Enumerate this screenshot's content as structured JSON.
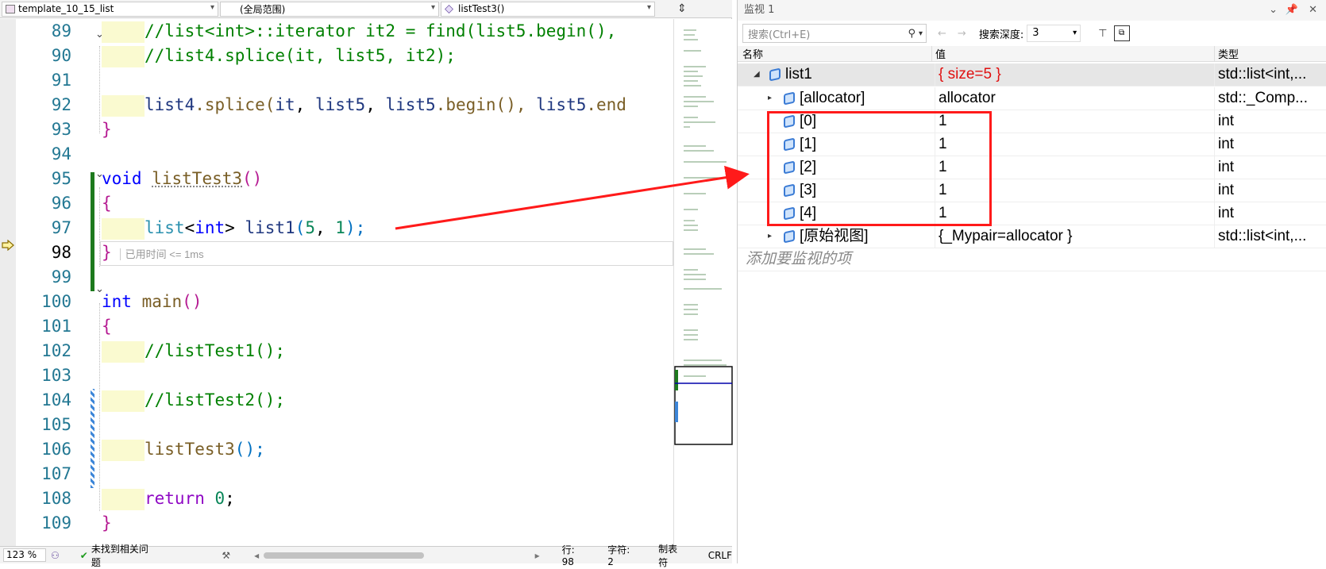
{
  "editor": {
    "nav": {
      "project": "template_10_15_list",
      "scope": "(全局范围)",
      "function": "listTest3()"
    },
    "lines": [
      89,
      90,
      91,
      92,
      93,
      94,
      95,
      96,
      97,
      98,
      99,
      100,
      101,
      102,
      103,
      104,
      105,
      106,
      107,
      108,
      109
    ],
    "code": {
      "l89": "//list<int>::iterator it2 = find(list5.begin(),",
      "l90": "//list4.splice(it, list5, it2);",
      "l92_a": "list4",
      "l92_b": ".splice(",
      "l92_c": "it",
      "l92_d": ", ",
      "l92_e": "list5",
      "l92_f": ", ",
      "l92_g": "list5",
      "l92_h": ".begin(), ",
      "l92_i": "list5",
      "l92_j": ".end",
      "l93": "}",
      "l95_kw": "void",
      "l95_fn": "listTest3",
      "l95_p": "()",
      "l96": "{",
      "l97_type": "list",
      "l97_t2": "<",
      "l97_kw": "int",
      "l97_t3": "> ",
      "l97_var": "list1",
      "l97_p1": "(",
      "l97_n1": "5",
      "l97_c": ", ",
      "l97_n2": "1",
      "l97_p2": ");",
      "l98": "}",
      "l98_hint": "已用时间 <= 1ms",
      "l100_kw": "int",
      "l100_fn": "main",
      "l100_p": "()",
      "l101": "{",
      "l102": "//listTest1();",
      "l104": "//listTest2();",
      "l106_fn": "listTest3",
      "l106_p": "();",
      "l108_kw": "return",
      "l108_n": "0",
      "l108_s": ";",
      "l109": "}"
    },
    "status": {
      "zoom": "123 %",
      "issues": "未找到相关问题",
      "line": "行: 98",
      "char": "字符: 2",
      "tabs": "制表符",
      "eol": "CRLF"
    }
  },
  "watch": {
    "title": "监视 1",
    "search_placeholder": "搜索(Ctrl+E)",
    "depth_label": "搜索深度:",
    "depth_value": "3",
    "col_name": "名称",
    "col_value": "值",
    "col_type": "类型",
    "rows": [
      {
        "name": "list1",
        "value": "{ size=5 }",
        "type": "std::list<int,..."
      },
      {
        "name": "[allocator]",
        "value": "allocator",
        "type": "std::_Comp..."
      },
      {
        "name": "[0]",
        "value": "1",
        "type": "int"
      },
      {
        "name": "[1]",
        "value": "1",
        "type": "int"
      },
      {
        "name": "[2]",
        "value": "1",
        "type": "int"
      },
      {
        "name": "[3]",
        "value": "1",
        "type": "int"
      },
      {
        "name": "[4]",
        "value": "1",
        "type": "int"
      },
      {
        "name": "[原始视图]",
        "value": "{_Mypair=allocator }",
        "type": "std::list<int,..."
      }
    ],
    "add_hint": "添加要监视的项"
  },
  "colors": {
    "highlight_red": "#ff1a1a",
    "changed_value": "#e01010"
  }
}
